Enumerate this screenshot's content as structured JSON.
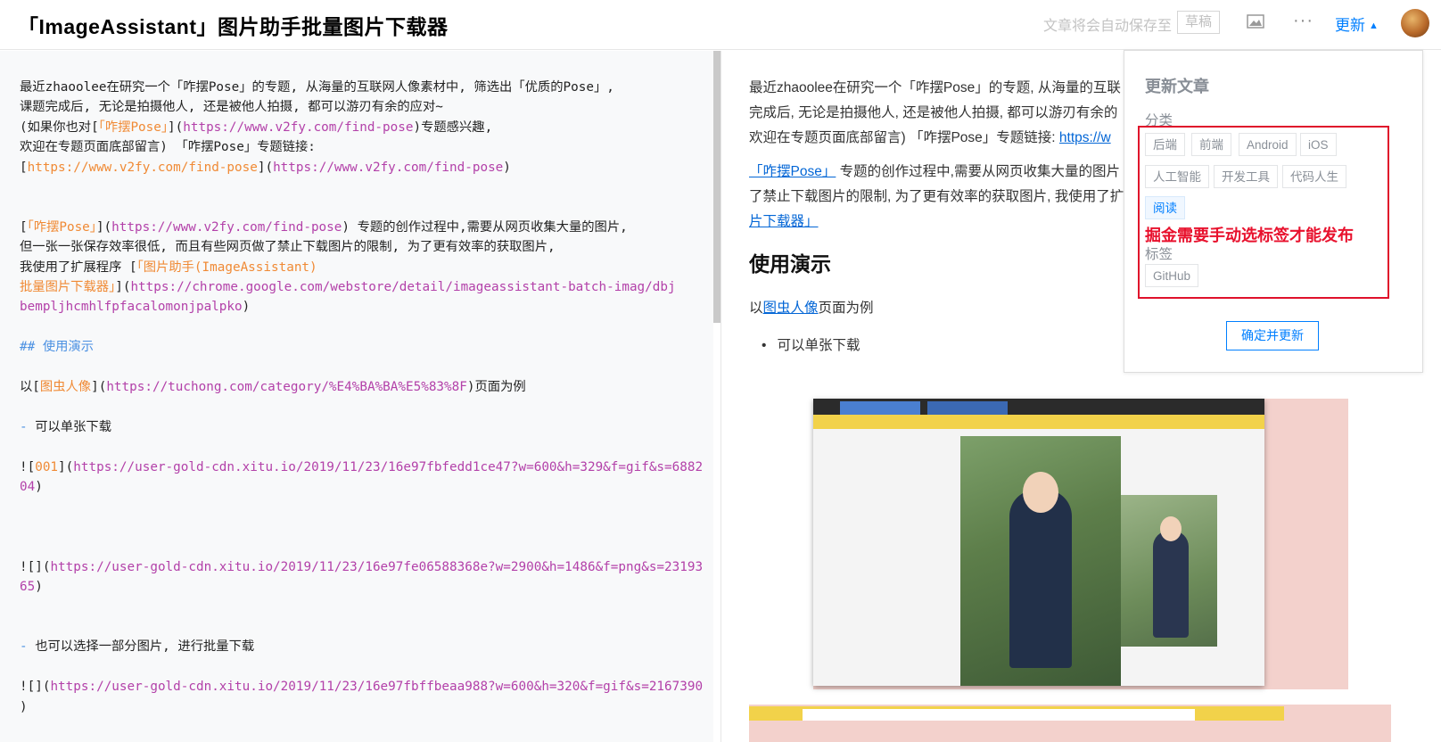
{
  "header": {
    "title": "「ImageAssistant」图片助手批量图片下载器",
    "autosave_text": "文章将会自动保存至",
    "draft_label": "草稿",
    "more_label": "···",
    "update_label": "更新",
    "caret": "▲"
  },
  "editor": {
    "l1": "最近zhaoolee在研究一个「咋摆Pose」的专题, 从海量的互联网人像素材中, 筛选出「优质的Pose」,",
    "l2": "课题完成后, 无论是拍摄他人, 还是被他人拍摄, 都可以游刃有余的应对~",
    "l3a": "(如果你也对[",
    "l3b": "「咋摆Pose」",
    "l3c": "](",
    "l3d": "https://www.v2fy.com/find-pose",
    "l3e": ")专题感兴趣,",
    "l4": "欢迎在专题页面底部留言) 「咋摆Pose」专题链接:",
    "l5a": "[",
    "l5b": "https://www.v2fy.com/find-pose",
    "l5c": "](",
    "l5d": "https://www.v2fy.com/find-pose",
    "l5e": ")",
    "l6a": "[",
    "l6b": "「咋摆Pose」",
    "l6c": "](",
    "l6d": "https://www.v2fy.com/find-pose",
    "l6e": ") 专题的创作过程中,需要从网页收集大量的图片,",
    "l7": "但一张一张保存效率很低, 而且有些网页做了禁止下载图片的限制, 为了更有效率的获取图片,",
    "l8a": "我使用了扩展程序 [",
    "l8b": "「图片助手(ImageAssistant)",
    "l9a": "批量图片下载器」",
    "l9b": "](",
    "l9c": "https://chrome.google.com/webstore/detail/imageassistant-batch-imag/dbj",
    "l10a": "bempljhcmhlfpfacalomonjpalpko",
    "l10b": ")",
    "l11": "## 使用演示",
    "l12a": "以[",
    "l12b": "图虫人像",
    "l12c": "](",
    "l12d": "https://tuchong.com/category/%E4%BA%BA%E5%83%8F",
    "l12e": ")页面为例",
    "l13a": "- ",
    "l13b": "可以单张下载",
    "l14a": "![",
    "l14b": "001",
    "l14c": "](",
    "l14d": "https://user-gold-cdn.xitu.io/2019/11/23/16e97fbfedd1ce47?w=600&h=329&f=gif&s=6882",
    "l15a": "04",
    "l15b": ")",
    "l16a": "![](",
    "l16b": "https://user-gold-cdn.xitu.io/2019/11/23/16e97fe06588368e?w=2900&h=1486&f=png&s=23193",
    "l17a": "65",
    "l17b": ")",
    "l18a": "- ",
    "l18b": "也可以选择一部分图片, 进行批量下载",
    "l19a": "![](",
    "l19b": "https://user-gold-cdn.xitu.io/2019/11/23/16e97fbffbeaa988?w=600&h=320&f=gif&s=2167390",
    "l20": ")"
  },
  "preview": {
    "p1_line1": "最近zhaoolee在研究一个「咋摆Pose」的专题, 从海量的互联",
    "p1_line2": "完成后, 无论是拍摄他人, 还是被他人拍摄, 都可以游刃有余的",
    "p1_line3a": "欢迎在专题页面底部留言) 「咋摆Pose」专题链接: ",
    "p1_link": "https://w",
    "p2_link1": "「咋摆Pose」",
    "p2_line1": " 专题的创作过程中,需要从网页收集大量的图片",
    "p2_line2": "了禁止下载图片的限制, 为了更有效率的获取图片, 我使用了扩",
    "p2_link2": "片下载器」",
    "h2": "使用演示",
    "p3a": "以",
    "p3_link": "图虫人像",
    "p3b": "页面为例",
    "li1": "可以单张下载"
  },
  "panel": {
    "title": "更新文章",
    "category_label": "分类",
    "categories": [
      "后端",
      "前端",
      "Android",
      "iOS",
      "人工智能",
      "开发工具",
      "代码人生",
      "阅读"
    ],
    "selected_category": "阅读",
    "annotation": "掘金需要手动选标签才能发布",
    "tag_label": "标签",
    "tags": [
      "GitHub"
    ],
    "confirm_label": "确定并更新"
  },
  "colors": {
    "accent": "#007fff",
    "annotation_red": "#e8112d",
    "md_link_orange": "#f08a35",
    "md_url_purple": "#b341a9",
    "md_heading_blue": "#4a90e2"
  }
}
